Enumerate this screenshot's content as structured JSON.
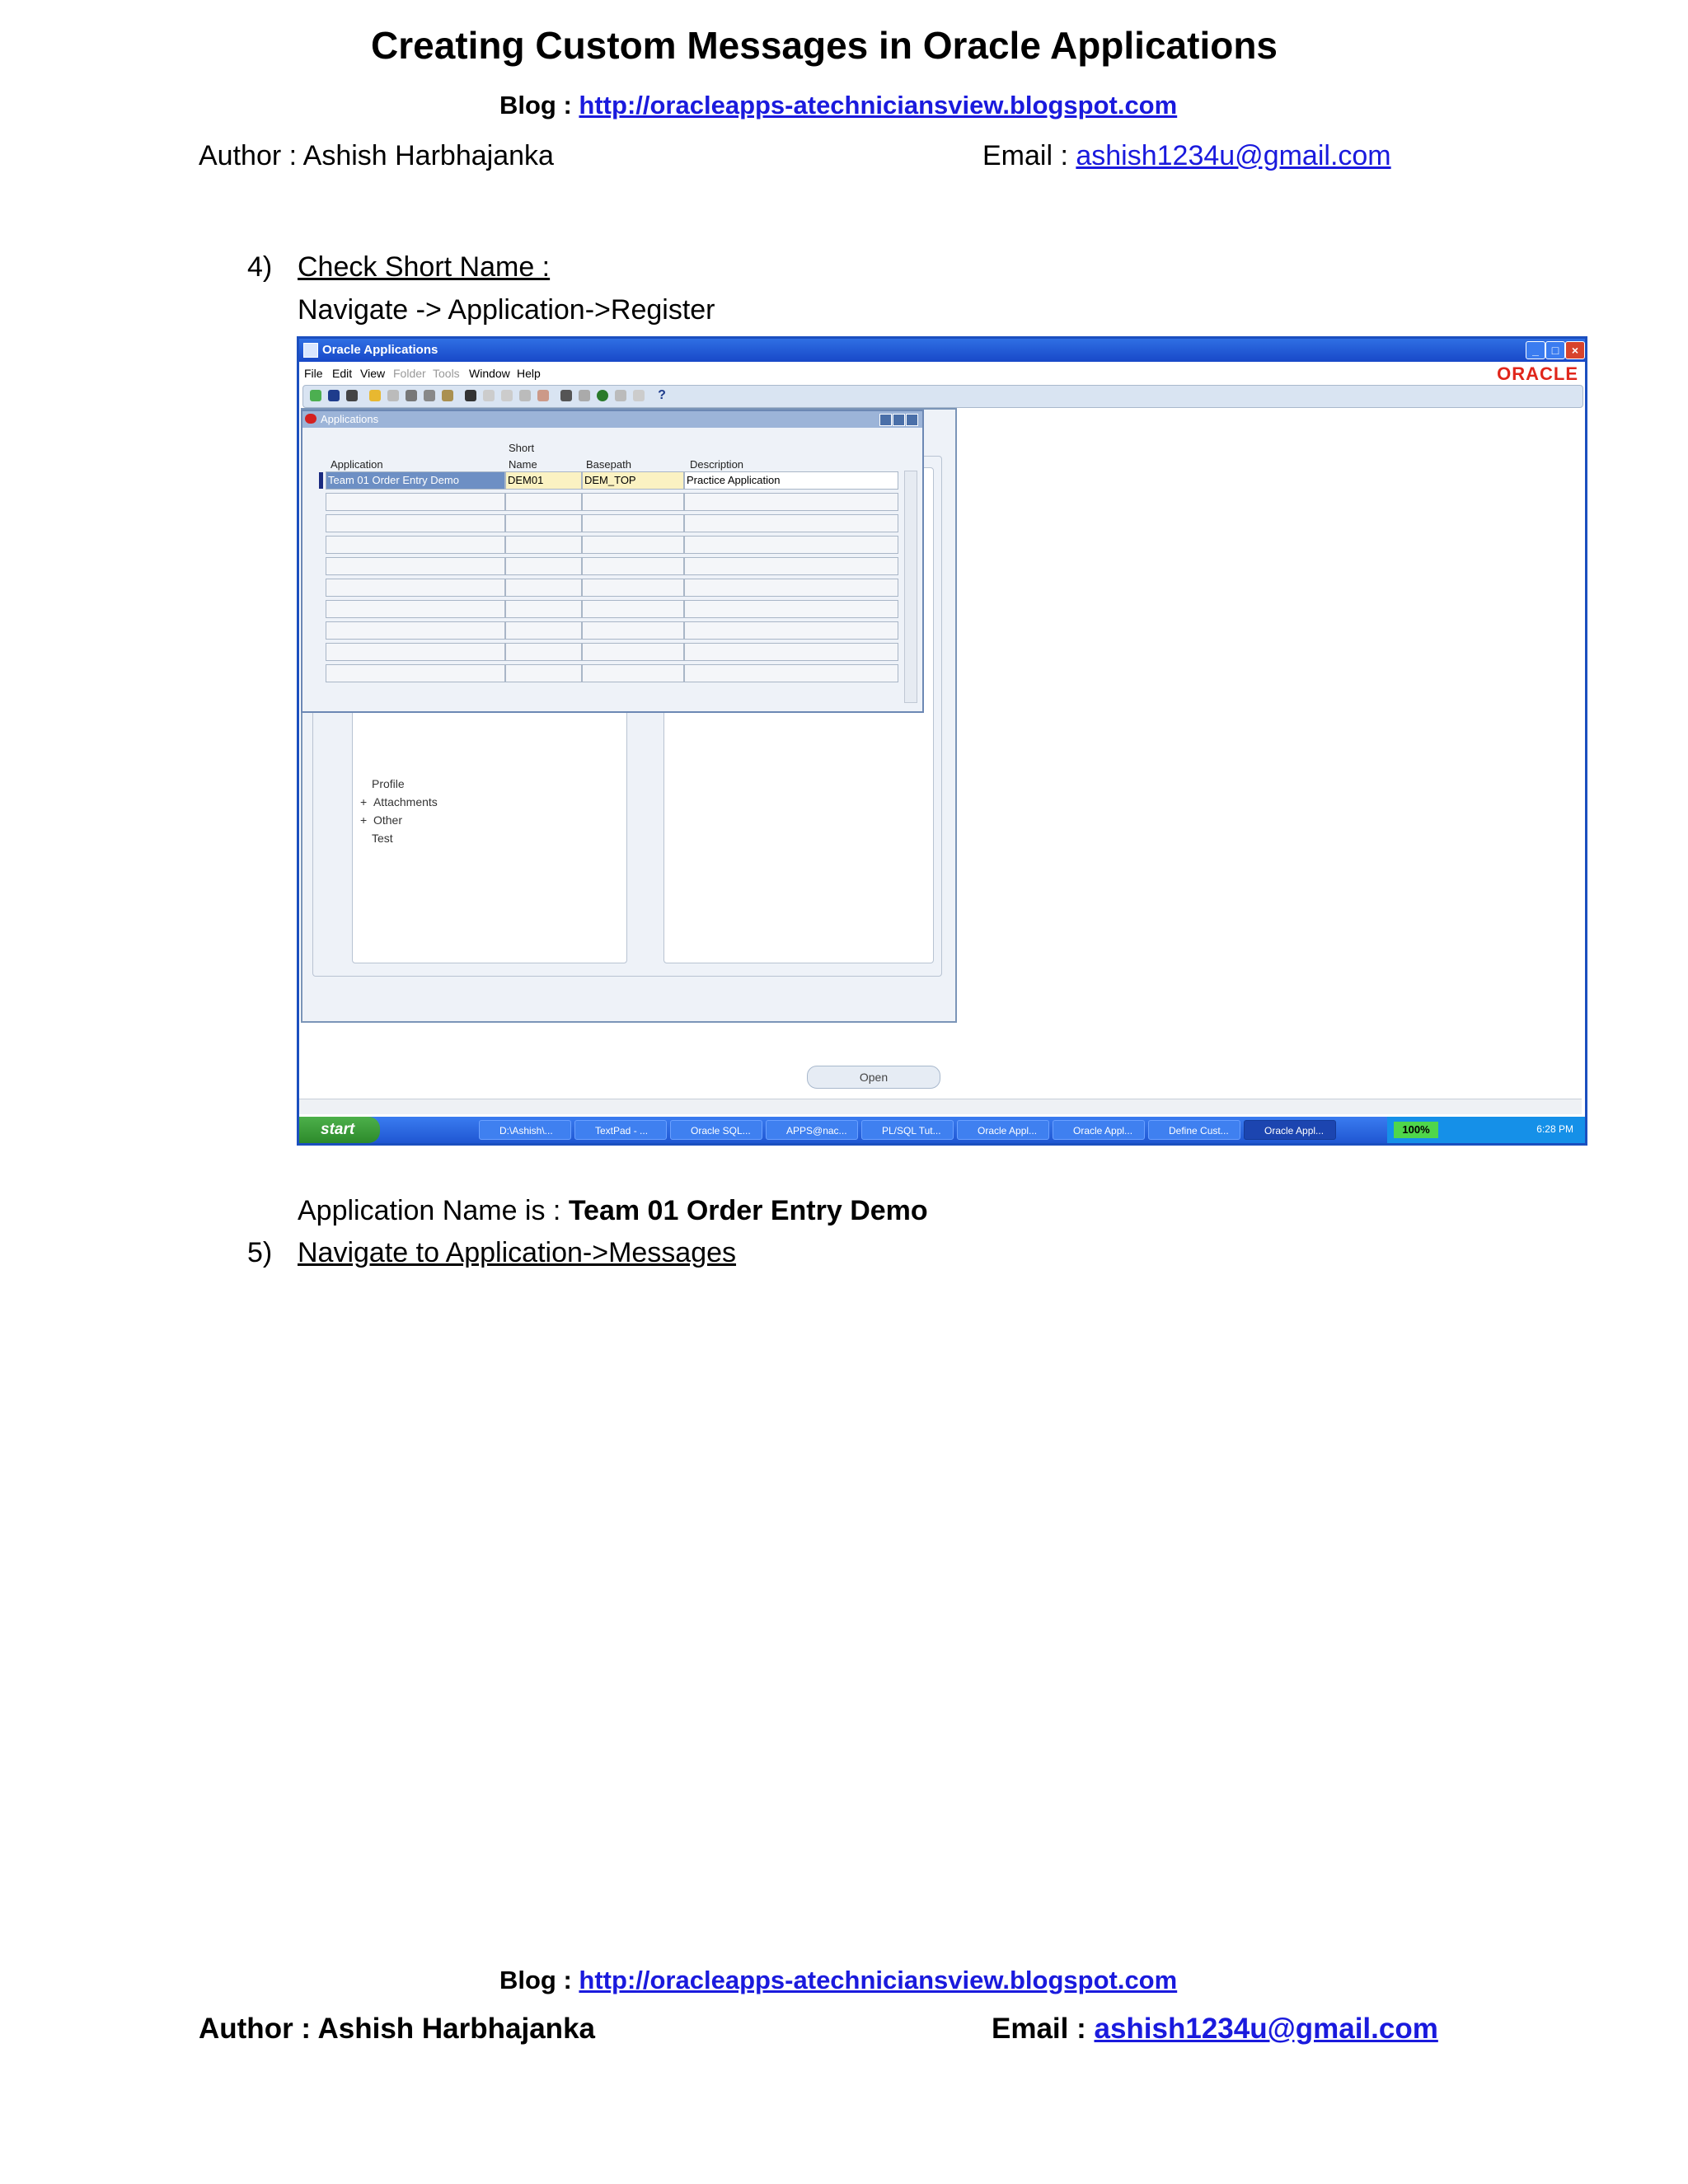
{
  "document": {
    "title": "Creating Custom Messages in Oracle Applications",
    "blog_label": "Blog : ",
    "blog_url": "http://oracleapps-atechniciansview.blogspot.com",
    "author_line": "Author : Ashish Harbhajanka",
    "email_label": "Email : ",
    "email": "ashish1234u@gmail.com"
  },
  "steps": {
    "step4_number": "4)",
    "step4_heading": "Check Short Name :",
    "step4_path": "Navigate -> Application->Register",
    "app_name_label": "Application Name is : ",
    "app_name_value": "Team 01 Order Entry Demo",
    "step5_number": "5)",
    "step5_heading": "Navigate to Application->Messages"
  },
  "screenshot": {
    "window_title": "Oracle Applications",
    "logo": "ORACLE",
    "menu": [
      "File",
      "Edit",
      "View",
      "Folder",
      "Tools",
      "Window",
      "Help"
    ],
    "form_title": "Applications",
    "columns": {
      "application": "Application",
      "short_name_line1": "Short",
      "short_name_line2": "Name",
      "basepath": "Basepath",
      "description": "Description"
    },
    "row": {
      "application": "Team 01 Order Entry Demo",
      "short_name": "DEM01",
      "basepath": "DEM_TOP",
      "description": "Practice Application"
    },
    "nav_items": [
      "Profile",
      "Attachments",
      "Other",
      "Test"
    ],
    "nav_prefix": "+",
    "open_button": "Open",
    "taskbar": {
      "start": "start",
      "tasks": [
        "D:\\Ashish\\...",
        "TextPad - ...",
        "Oracle SQL...",
        "APPS@nac...",
        "PL/SQL Tut...",
        "Oracle Appl...",
        "Oracle Appl...",
        "Define Cust...",
        "Oracle Appl..."
      ],
      "battery": "100%",
      "clock": "6:28 PM"
    }
  }
}
